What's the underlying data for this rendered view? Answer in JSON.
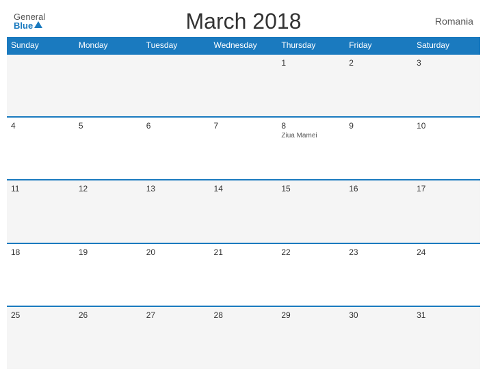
{
  "header": {
    "logo_general": "General",
    "logo_blue": "Blue",
    "title": "March 2018",
    "country": "Romania"
  },
  "weekdays": [
    "Sunday",
    "Monday",
    "Tuesday",
    "Wednesday",
    "Thursday",
    "Friday",
    "Saturday"
  ],
  "weeks": [
    [
      {
        "day": "",
        "event": ""
      },
      {
        "day": "",
        "event": ""
      },
      {
        "day": "",
        "event": ""
      },
      {
        "day": "",
        "event": ""
      },
      {
        "day": "1",
        "event": ""
      },
      {
        "day": "2",
        "event": ""
      },
      {
        "day": "3",
        "event": ""
      }
    ],
    [
      {
        "day": "4",
        "event": ""
      },
      {
        "day": "5",
        "event": ""
      },
      {
        "day": "6",
        "event": ""
      },
      {
        "day": "7",
        "event": ""
      },
      {
        "day": "8",
        "event": "Ziua Mamei"
      },
      {
        "day": "9",
        "event": ""
      },
      {
        "day": "10",
        "event": ""
      }
    ],
    [
      {
        "day": "11",
        "event": ""
      },
      {
        "day": "12",
        "event": ""
      },
      {
        "day": "13",
        "event": ""
      },
      {
        "day": "14",
        "event": ""
      },
      {
        "day": "15",
        "event": ""
      },
      {
        "day": "16",
        "event": ""
      },
      {
        "day": "17",
        "event": ""
      }
    ],
    [
      {
        "day": "18",
        "event": ""
      },
      {
        "day": "19",
        "event": ""
      },
      {
        "day": "20",
        "event": ""
      },
      {
        "day": "21",
        "event": ""
      },
      {
        "day": "22",
        "event": ""
      },
      {
        "day": "23",
        "event": ""
      },
      {
        "day": "24",
        "event": ""
      }
    ],
    [
      {
        "day": "25",
        "event": ""
      },
      {
        "day": "26",
        "event": ""
      },
      {
        "day": "27",
        "event": ""
      },
      {
        "day": "28",
        "event": ""
      },
      {
        "day": "29",
        "event": ""
      },
      {
        "day": "30",
        "event": ""
      },
      {
        "day": "31",
        "event": ""
      }
    ]
  ]
}
